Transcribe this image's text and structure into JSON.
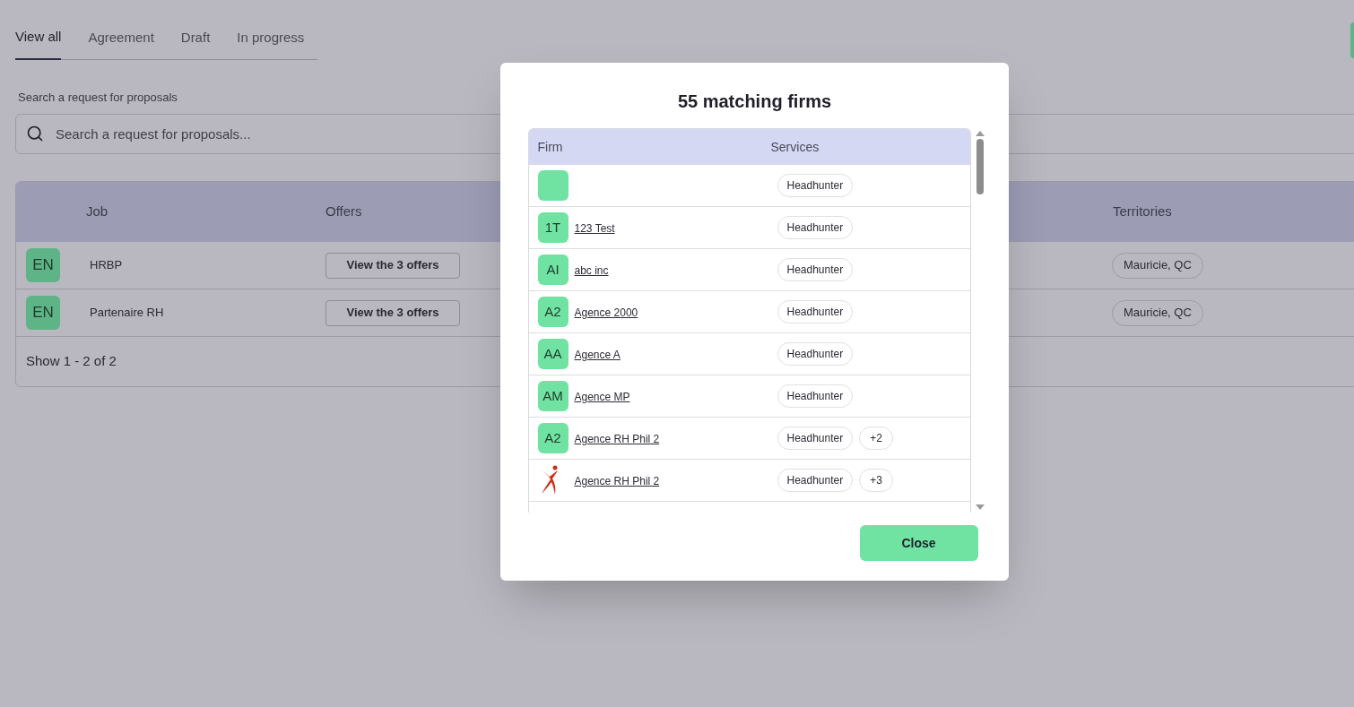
{
  "tabs": [
    {
      "label": "View all",
      "selected": true
    },
    {
      "label": "Agreement",
      "selected": false
    },
    {
      "label": "Draft",
      "selected": false
    },
    {
      "label": "In progress",
      "selected": false
    }
  ],
  "search": {
    "label": "Search a request for proposals",
    "placeholder": "Search a request for proposals..."
  },
  "table": {
    "columns": {
      "job": "Job",
      "offers": "Offers",
      "territories": "Territories"
    },
    "rows": [
      {
        "avatar": "EN",
        "job": "HRBP",
        "offers_button": "View the 3 offers",
        "territory": "Mauricie, QC"
      },
      {
        "avatar": "EN",
        "job": "Partenaire RH",
        "offers_button": "View the 3 offers",
        "territory": "Mauricie, QC"
      }
    ],
    "footer": "Show 1 - 2 of 2"
  },
  "modal": {
    "title": "55 matching firms",
    "columns": {
      "firm": "Firm",
      "services": "Services"
    },
    "firms": [
      {
        "kind": "avatar",
        "services": [
          "Headhunter"
        ]
      },
      {
        "kind": "avatar",
        "initials": "1T",
        "name": "123 Test",
        "services": [
          "Headhunter"
        ]
      },
      {
        "kind": "avatar",
        "initials": "AI",
        "name": "abc inc",
        "services": [
          "Headhunter"
        ]
      },
      {
        "kind": "avatar",
        "initials": "A2",
        "name": "Agence 2000",
        "services": [
          "Headhunter"
        ]
      },
      {
        "kind": "avatar",
        "initials": "AA",
        "name": "Agence A",
        "services": [
          "Headhunter"
        ]
      },
      {
        "kind": "avatar",
        "initials": "AM",
        "name": "Agence MP",
        "services": [
          "Headhunter"
        ]
      },
      {
        "kind": "avatar",
        "initials": "A2",
        "name": "Agence RH Phil 2",
        "services": [
          "Headhunter"
        ],
        "more": "+2"
      },
      {
        "kind": "logo",
        "name": "Agence RH Phil 2",
        "services": [
          "Headhunter"
        ],
        "more": "+3"
      }
    ],
    "close_button": "Close"
  }
}
